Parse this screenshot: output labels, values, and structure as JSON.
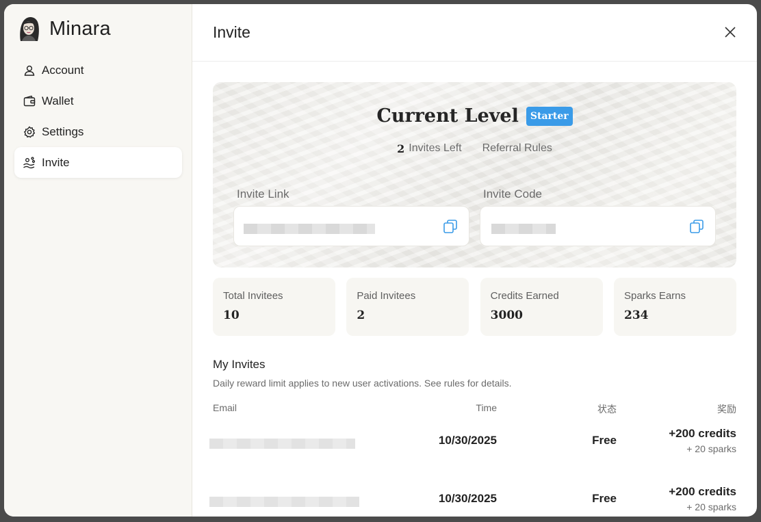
{
  "brand": {
    "name": "Minara"
  },
  "sidebar": {
    "items": [
      {
        "label": "Account",
        "icon": "user-icon"
      },
      {
        "label": "Wallet",
        "icon": "wallet-icon"
      },
      {
        "label": "Settings",
        "icon": "gear-icon"
      },
      {
        "label": "Invite",
        "icon": "invite-icon",
        "active": true
      }
    ]
  },
  "header": {
    "title": "Invite"
  },
  "hero": {
    "level_title": "Current Level",
    "level_badge": "Starter",
    "invites_left_count": "2",
    "invites_left_label": "Invites Left",
    "referral_rules": "Referral Rules",
    "invite_link_label": "Invite Link",
    "invite_code_label": "Invite Code"
  },
  "stats": [
    {
      "label": "Total Invitees",
      "value": "10"
    },
    {
      "label": "Paid Invitees",
      "value": "2"
    },
    {
      "label": "Credits Earned",
      "value": "3000"
    },
    {
      "label": "Sparks Earns",
      "value": "234"
    }
  ],
  "invites": {
    "title": "My Invites",
    "description": "Daily reward limit applies to new user activations. See rules for details.",
    "columns": {
      "email": "Email",
      "time": "Time",
      "status": "状态",
      "reward": "奖励"
    },
    "rows": [
      {
        "time": "10/30/2025",
        "status": "Free",
        "credits": "+200 credits",
        "sparks": "+ 20 sparks"
      },
      {
        "time": "10/30/2025",
        "status": "Free",
        "credits": "+200 credits",
        "sparks": "+ 20 sparks"
      }
    ]
  },
  "colors": {
    "accent": "#3a9be8",
    "sidebar_bg": "#f8f7f3",
    "card_bg": "#f7f6f2"
  }
}
